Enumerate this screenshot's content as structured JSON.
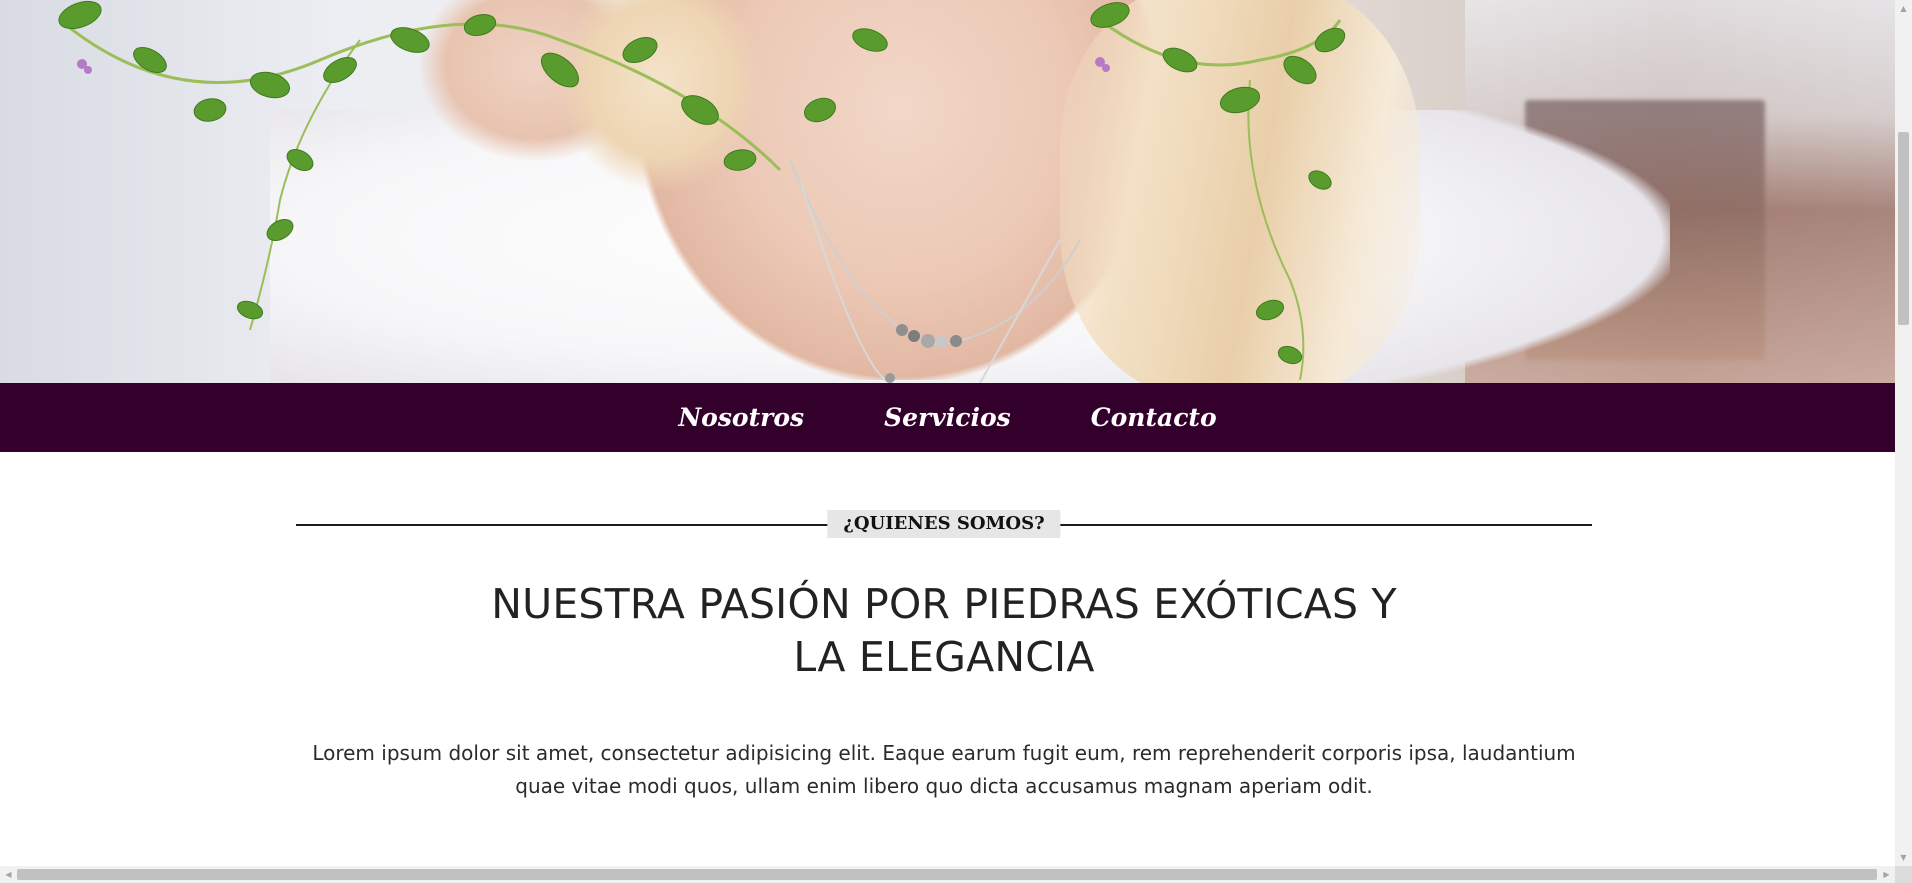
{
  "nav": {
    "items": [
      {
        "label": "Nosotros"
      },
      {
        "label": "Servicios"
      },
      {
        "label": "Contacto"
      }
    ]
  },
  "about": {
    "section_label": "¿QUIENES SOMOS?",
    "headline_line1": "NUESTRA PASIÓN POR PIEDRAS EXÓTICAS Y",
    "headline_line2": "LA ELEGANCIA",
    "body": "Lorem ipsum dolor sit amet, consectetur adipisicing elit. Eaque earum fugit eum, rem reprehenderit corporis ipsa, laudantium quae vitae modi quos, ullam enim libero quo dicta accusamus magnam aperiam odit."
  },
  "hero": {
    "image_icon": "hero-photo-woman-necklace",
    "decoration_icon": "ivy-vine-icon"
  },
  "colors": {
    "nav_background": "#33002b",
    "nav_text": "#ffffff",
    "section_label_background": "#e6e6e6",
    "text": "#222222"
  }
}
